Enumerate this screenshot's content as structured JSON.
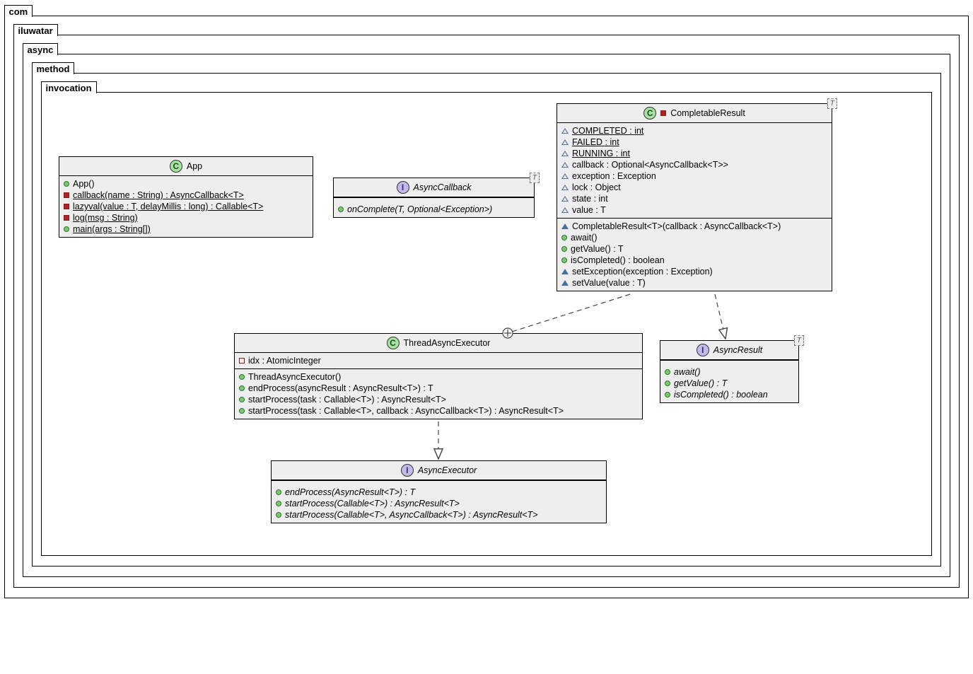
{
  "packages": [
    "com",
    "iluwatar",
    "async",
    "method",
    "invocation"
  ],
  "classes": {
    "app": {
      "kind": "C",
      "name": "App",
      "members": [
        {
          "vis": "dot",
          "text": "App()",
          "style": ""
        },
        {
          "vis": "sq-red-fill",
          "text": "callback(name : String) : AsyncCallback<T>",
          "style": "underline"
        },
        {
          "vis": "sq-red-fill",
          "text": "lazyval(value : T, delayMillis : long) : Callable<T>",
          "style": "underline"
        },
        {
          "vis": "sq-red-fill",
          "text": "log(msg : String)",
          "style": "underline"
        },
        {
          "vis": "dot",
          "text": "main(args : String[])",
          "style": "underline"
        }
      ]
    },
    "asyncCallback": {
      "kind": "I",
      "name": "AsyncCallback",
      "tparam": "T",
      "members": [
        {
          "vis": "dot",
          "text": "onComplete(T, Optional<Exception>)",
          "style": "italic"
        }
      ]
    },
    "completableResult": {
      "kind": "C",
      "name": "CompletableResult",
      "tparam": "T",
      "leadVis": "sq-red-fill",
      "fields": [
        {
          "vis": "tri-blue-open",
          "text": "COMPLETED : int",
          "style": "underline"
        },
        {
          "vis": "tri-blue-open",
          "text": "FAILED : int",
          "style": "underline"
        },
        {
          "vis": "tri-blue-open",
          "text": "RUNNING : int",
          "style": "underline"
        },
        {
          "vis": "tri-blue-open",
          "text": "callback : Optional<AsyncCallback<T>>",
          "style": ""
        },
        {
          "vis": "tri-blue-open",
          "text": "exception : Exception",
          "style": ""
        },
        {
          "vis": "tri-blue-open",
          "text": "lock : Object",
          "style": ""
        },
        {
          "vis": "tri-blue-open",
          "text": "state : int",
          "style": ""
        },
        {
          "vis": "tri-blue-open",
          "text": "value : T",
          "style": ""
        }
      ],
      "methods": [
        {
          "vis": "tri-blue-fill",
          "text": "CompletableResult<T>(callback : AsyncCallback<T>)",
          "style": ""
        },
        {
          "vis": "dot",
          "text": "await()",
          "style": ""
        },
        {
          "vis": "dot",
          "text": "getValue() : T",
          "style": ""
        },
        {
          "vis": "dot",
          "text": "isCompleted() : boolean",
          "style": ""
        },
        {
          "vis": "tri-blue-fill",
          "text": "setException(exception : Exception)",
          "style": ""
        },
        {
          "vis": "tri-blue-fill",
          "text": "setValue(value : T)",
          "style": ""
        }
      ]
    },
    "threadAsyncExecutor": {
      "kind": "C",
      "name": "ThreadAsyncExecutor",
      "fields": [
        {
          "vis": "sq-red-open",
          "text": "idx : AtomicInteger",
          "style": ""
        }
      ],
      "methods": [
        {
          "vis": "dot",
          "text": "ThreadAsyncExecutor()",
          "style": ""
        },
        {
          "vis": "dot",
          "text": "endProcess(asyncResult : AsyncResult<T>) : T",
          "style": ""
        },
        {
          "vis": "dot",
          "text": "startProcess(task : Callable<T>) : AsyncResult<T>",
          "style": ""
        },
        {
          "vis": "dot",
          "text": "startProcess(task : Callable<T>, callback : AsyncCallback<T>) : AsyncResult<T>",
          "style": ""
        }
      ]
    },
    "asyncResult": {
      "kind": "I",
      "name": "AsyncResult",
      "tparam": "T",
      "members": [
        {
          "vis": "dot",
          "text": "await()",
          "style": "italic"
        },
        {
          "vis": "dot",
          "text": "getValue() : T",
          "style": "italic"
        },
        {
          "vis": "dot",
          "text": "isCompleted() : boolean",
          "style": "italic"
        }
      ]
    },
    "asyncExecutor": {
      "kind": "I",
      "name": "AsyncExecutor",
      "members": [
        {
          "vis": "dot",
          "text": "endProcess(AsyncResult<T>) : T",
          "style": "italic"
        },
        {
          "vis": "dot",
          "text": "startProcess(Callable<T>) : AsyncResult<T>",
          "style": "italic"
        },
        {
          "vis": "dot",
          "text": "startProcess(Callable<T>, AsyncCallback<T>) : AsyncResult<T>",
          "style": "italic"
        }
      ]
    }
  }
}
